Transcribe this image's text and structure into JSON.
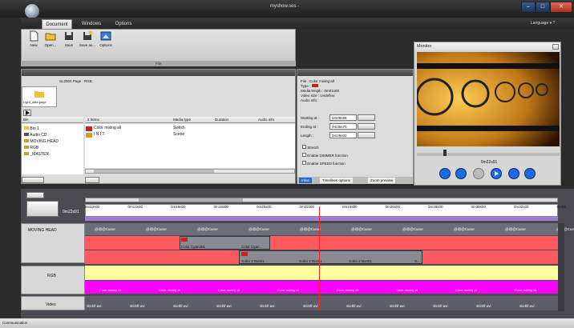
{
  "window": {
    "title": "myshow.ses -",
    "language": "Language",
    "help": "?"
  },
  "tabs": [
    "Document",
    "Windows",
    "Options"
  ],
  "ribbon": {
    "buttons": [
      "New",
      "Open...",
      "Save",
      "Save as...",
      "Options"
    ],
    "caption": "File"
  },
  "page_header": "SL2004 Page : RGB",
  "folder_label": "Light_data page",
  "bin": {
    "header": "Bin",
    "items": [
      "Bin 1",
      "Audio CD",
      "MOVING HEAD",
      "RGB",
      "_MASTER"
    ]
  },
  "items_table": {
    "columns": [
      "2 Items",
      "Media type",
      "Duration",
      "Audio info"
    ],
    "rows": [
      [
        "Color mixing all",
        "Switch",
        "",
        ""
      ],
      [
        "I N I T",
        "Scene",
        "",
        ""
      ]
    ]
  },
  "info": {
    "file": "File : Color mixing all",
    "type": "Type :",
    "media_length": "Media length : 0m01s00",
    "video_size": "Video size : Undefine",
    "audio_info": "Audio info :",
    "starting_label": "Starting at :",
    "starting_val": "0m09s68",
    "ending_label": "Ending at :",
    "ending_val": "0m35s70",
    "length_label": "Length :",
    "length_val": "0m26s02",
    "checks": [
      "Stretch",
      "Enable DIMMER function",
      "Enable SPEED function"
    ],
    "tabs": [
      "Infos",
      "Timelines options",
      "Zoom preview"
    ]
  },
  "monitor": {
    "title": "Monitor",
    "time": "0m22s91"
  },
  "timeline": {
    "current": "0m22s91",
    "ticks": [
      "0m12s00",
      "0m14s00",
      "0m16s00",
      "0m18s00",
      "0m20s00",
      "0m22s00",
      "0m24s00",
      "0m26s00",
      "0m28s00",
      "0m30s00",
      "0m32s00",
      "0m34"
    ],
    "tracks": {
      "moving_head": "MOVING HEAD",
      "rgb": "RGB",
      "video": "Video"
    },
    "curve": "@@@Curve",
    "clips": {
      "cyan1": "Color Cyan401",
      "cyan2": "Color Cyan...",
      "gobo": "Gobo 2 Burst1",
      "gobo_g": "G...",
      "mixing": "Color mixing all",
      "video": "stickfr.avi"
    }
  },
  "status": "Communication",
  "colors": {
    "red": "#ff5a5f",
    "yellow": "#ffff9e",
    "magenta": "#ff00ff",
    "grey": "#6e6e78",
    "cursor": "#ff2222"
  }
}
